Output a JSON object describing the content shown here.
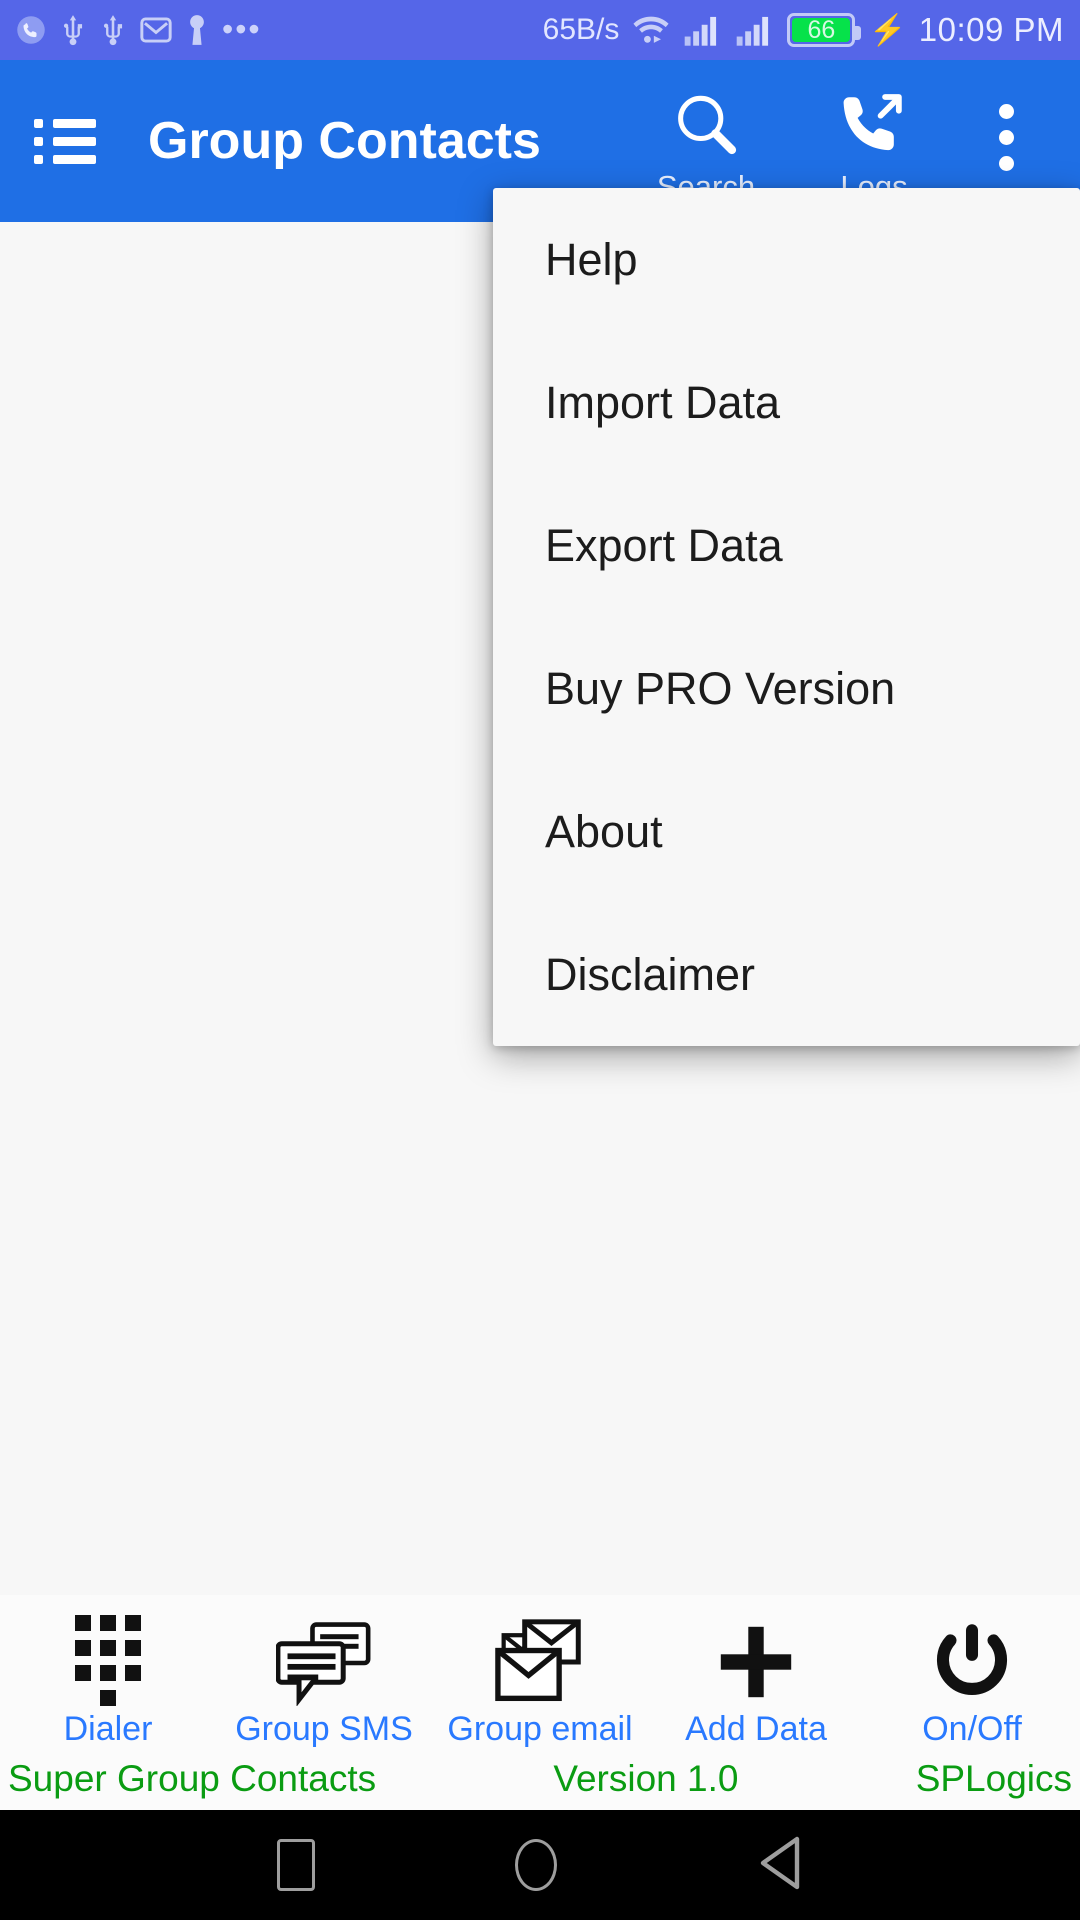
{
  "status_bar": {
    "left_icons": [
      "phone-circle-icon",
      "usb-icon",
      "usb-icon",
      "gmail-icon",
      "keyhole-icon",
      "more-dots-icon"
    ],
    "network_speed": "65B/s",
    "wifi_icon": "wifi-icon",
    "signal_icons": [
      "signal-bars-icon",
      "signal-bars-icon"
    ],
    "battery_percent": "66",
    "charging_icon": "charging-bolt-icon",
    "time": "10:09 PM",
    "background_color": "#5566e8"
  },
  "app_bar": {
    "menu_icon": "hamburger-list-icon",
    "title": "Group Contacts",
    "background_color": "#1f6fe5",
    "actions": [
      {
        "label": "Search",
        "icon": "search-icon"
      },
      {
        "label": "Logs",
        "icon": "call-log-icon"
      }
    ],
    "overflow_icon": "overflow-menu-icon"
  },
  "overflow_menu": {
    "items": [
      {
        "label": "Help"
      },
      {
        "label": "Import Data"
      },
      {
        "label": "Export Data"
      },
      {
        "label": "Buy PRO Version"
      },
      {
        "label": "About"
      },
      {
        "label": "Disclaimer"
      }
    ],
    "background_color": "#f7f7f7"
  },
  "bottom_bar": {
    "label_color": "#2979ff",
    "items": [
      {
        "label": "Dialer",
        "icon": "dialpad-icon"
      },
      {
        "label": "Group SMS",
        "icon": "chat-bubbles-icon"
      },
      {
        "label": "Group email",
        "icon": "envelopes-icon"
      },
      {
        "label": "Add Data",
        "icon": "plus-icon"
      },
      {
        "label": "On/Off",
        "icon": "power-icon"
      }
    ],
    "footer": {
      "app_name": "Super Group Contacts",
      "version": "Version 1.0",
      "vendor": "SPLogics",
      "color": "#0a9c12"
    }
  },
  "nav_bar": {
    "recents_icon": "recents-square-icon",
    "home_icon": "home-circle-icon",
    "back_icon": "back-triangle-icon",
    "background_color": "#000000"
  }
}
